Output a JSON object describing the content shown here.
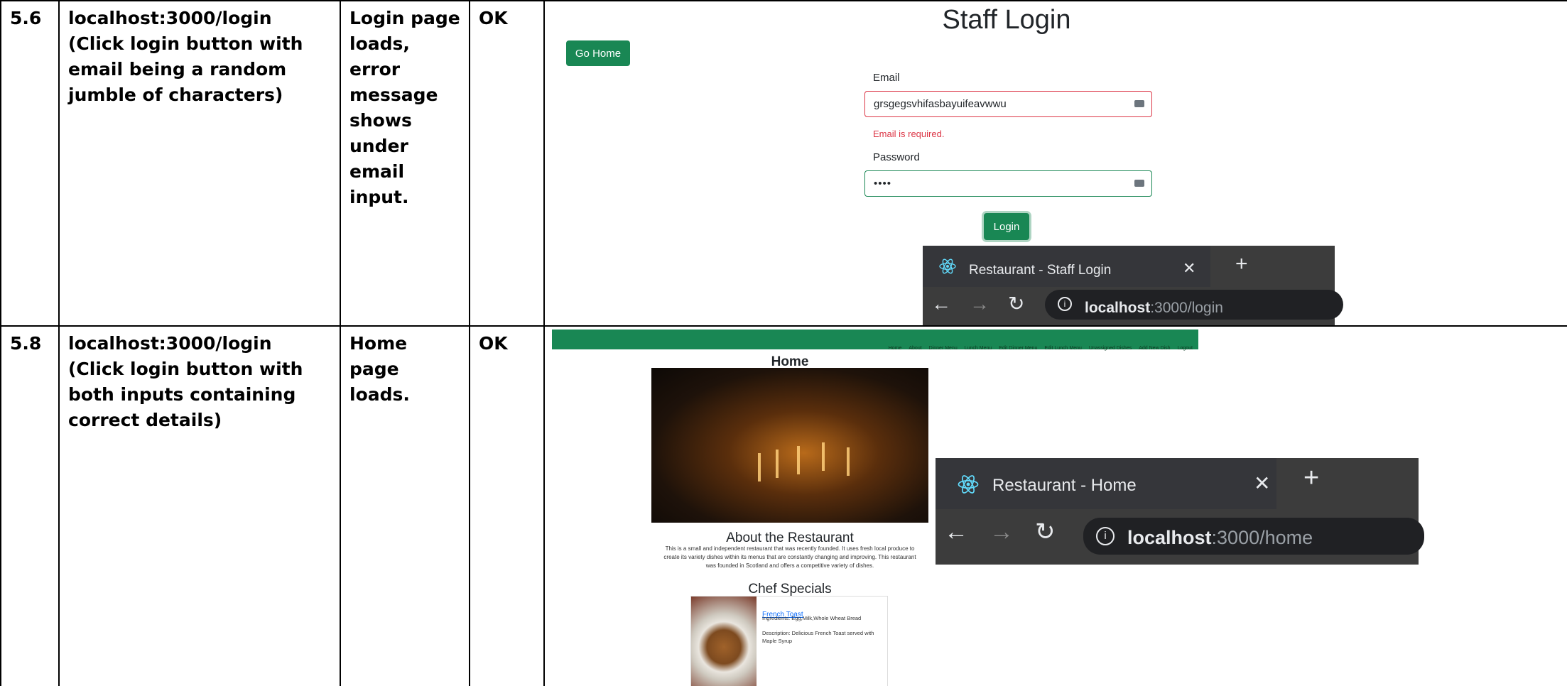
{
  "rows": [
    {
      "id": "5.6",
      "test": "localhost:3000/login\n(Click login button with email being a random jumble of characters)",
      "expected": "Login page loads, error message shows under email input.",
      "result": "OK",
      "screenshot": {
        "title": "Staff Login",
        "go_home_label": "Go Home",
        "email_label": "Email",
        "email_value": "grsgegsvhifasbayuifeavwwu",
        "email_error": "Email is required.",
        "password_label": "Password",
        "password_value": "••••",
        "login_label": "Login",
        "browser": {
          "tab_title": "Restaurant - Staff Login",
          "url_host": "localhost",
          "url_path": ":3000/login"
        }
      }
    },
    {
      "id": "5.8",
      "test": "localhost:3000/login\n(Click login button with both inputs containing correct details)",
      "expected": "Home page loads.",
      "result": "OK",
      "screenshot": {
        "nav_items": [
          "Home",
          "About",
          "Dinner Menu",
          "Lunch Menu",
          "Edit Dinner Menu",
          "Edit Lunch Menu",
          "Unassigned Dishes",
          "Add New Dish",
          "Logout"
        ],
        "home_title": "Home",
        "about_title": "About the Restaurant",
        "about_text": "This is a small and independent restaurant that was recently founded. It uses fresh local produce to create its variety dishes within its menus that are constantly changing and improving. This restaurant was founded in Scotland and offers a competitive variety of dishes.",
        "specials_title": "Chef Specials",
        "special": {
          "name": "French Toast",
          "ingredients": "Ingredients: Egg,Milk,Whole Wheat Bread",
          "description": "Description: Delicious French Toast served with Maple Syrup"
        },
        "browser": {
          "tab_title": "Restaurant - Home",
          "url_host": "localhost",
          "url_path": ":3000/home"
        }
      }
    }
  ],
  "colors": {
    "primary_green": "#198754",
    "error_red": "#dc3545",
    "browser_dark": "#3c3c3c"
  }
}
